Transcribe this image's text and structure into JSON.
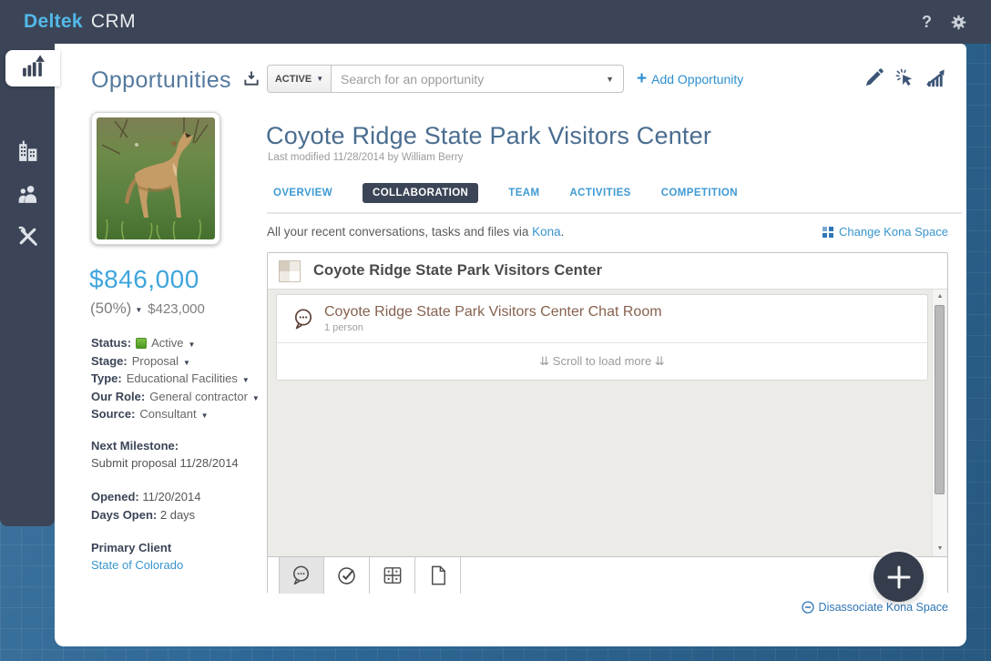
{
  "colors": {
    "topbar_bg": "#3b4557",
    "brand_blue": "#52b9e9",
    "link_blue": "#3794cc",
    "accent_blue": "#3fa5dd",
    "status_green": "#55a630",
    "chat_brown": "#87624f",
    "bg_tile_blue": "#2e6795"
  },
  "topbar": {
    "brand": "Deltek",
    "product": "CRM",
    "help_label": "?"
  },
  "sidebar": {
    "items": [
      {
        "name": "opportunities",
        "icon": "bar-chart-arrow-icon",
        "active": true
      },
      {
        "name": "firms",
        "icon": "buildings-icon",
        "active": false
      },
      {
        "name": "contacts",
        "icon": "people-icon",
        "active": false
      },
      {
        "name": "tools",
        "icon": "tools-icon",
        "active": false
      }
    ]
  },
  "left_panel": {
    "title": "Opportunities",
    "amount": "$846,000",
    "probability": "(50%)",
    "weighted": "$423,000",
    "fields": [
      {
        "label": "Status:",
        "value": "Active",
        "status_dot": true
      },
      {
        "label": "Stage:",
        "value": "Proposal"
      },
      {
        "label": "Type:",
        "value": "Educational Facilities"
      },
      {
        "label": "Our Role:",
        "value": "General contractor"
      },
      {
        "label": "Source:",
        "value": "Consultant"
      }
    ],
    "next_milestone_label": "Next Milestone:",
    "next_milestone_value": "Submit proposal 11/28/2014",
    "opened_label": "Opened:",
    "opened_value": "11/20/2014",
    "days_open_label": "Days Open:",
    "days_open_value": "2 days",
    "primary_client_label": "Primary Client",
    "primary_client_value": "State of Colorado"
  },
  "toolbar": {
    "filter_label": "ACTIVE",
    "search_placeholder": "Search for an opportunity",
    "add_plus": "+",
    "add_label": "Add Opportunity"
  },
  "record": {
    "title": "Coyote Ridge State Park Visitors Center",
    "subtitle": "Last modified 11/28/2014 by William Berry",
    "tabs": [
      {
        "label": "OVERVIEW",
        "active": false
      },
      {
        "label": "COLLABORATION",
        "active": true
      },
      {
        "label": "TEAM",
        "active": false
      },
      {
        "label": "ACTIVITIES",
        "active": false
      },
      {
        "label": "COMPETITION",
        "active": false
      }
    ]
  },
  "kona": {
    "intro_prefix": "All your recent conversations, tasks and files via ",
    "intro_link": "Kona",
    "intro_suffix": ".",
    "change_space": "Change Kona Space",
    "space_title": "Coyote Ridge State Park Visitors Center",
    "chat_room_title": "Coyote Ridge State Park Visitors Center Chat Room",
    "chat_room_members": "1 person",
    "scroll_hint": "⇊ Scroll to load more ⇊",
    "disassociate": "Disassociate Kona Space"
  }
}
